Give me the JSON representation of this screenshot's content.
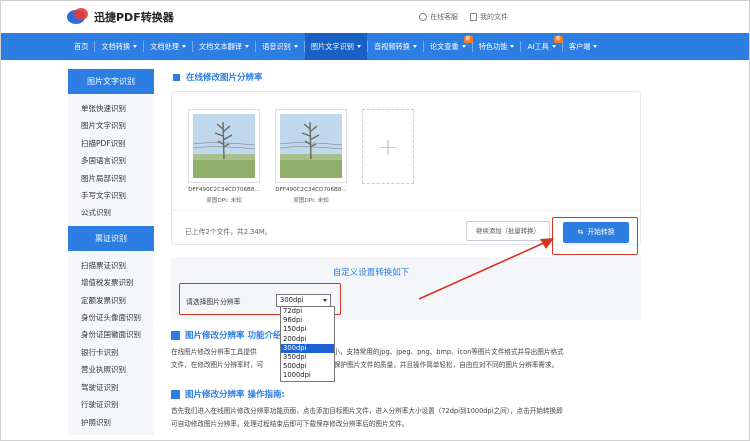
{
  "header": {
    "logo_text": "迅捷PDF转换器",
    "links": [
      "在线客服",
      "我的文件"
    ]
  },
  "nav": {
    "items": [
      {
        "label": "首页",
        "caret": false
      },
      {
        "label": "文档转换",
        "caret": true
      },
      {
        "label": "文档处理",
        "caret": true
      },
      {
        "label": "文档文本翻译",
        "caret": true
      },
      {
        "label": "语音识别",
        "caret": true
      },
      {
        "label": "图片文字识别",
        "caret": true,
        "active": true
      },
      {
        "label": "音视频转换",
        "caret": true
      },
      {
        "label": "论文查重",
        "caret": true,
        "badge": "新"
      },
      {
        "label": "特色功能",
        "caret": true
      },
      {
        "label": "AI工具",
        "caret": true,
        "badge": "新"
      },
      {
        "label": "客户端",
        "caret": true
      }
    ]
  },
  "sidebar": {
    "section1_title": "图片文字识别",
    "section1_items": [
      "单张快速识别",
      "图片文字识别",
      "扫描PDF识别",
      "多国语言识别",
      "图片局部识别",
      "手写文字识别",
      "公式识别"
    ],
    "section2_title": "票证识别",
    "section2_items": [
      "扫描票证识别",
      "增值税发票识别",
      "定额发票识别",
      "身份证头像面识别",
      "身份证国徽面识别",
      "银行卡识别",
      "营业执照识别",
      "驾驶证识别",
      "行驶证识别",
      "护照识别"
    ]
  },
  "main": {
    "title": "在线修改图片分辨率",
    "files": [
      {
        "name": "DFF490C2C34CD706B8...",
        "dpi": "原图DPI: 未知"
      },
      {
        "name": "DFF490C2C34CD706B8...",
        "dpi": "原图DPI: 未知"
      }
    ],
    "add_symbol": "+",
    "upload_count": "已上传2个文件，共2.34M。",
    "continue_button": "继续添加（批量转换）",
    "start_button": "开始转换",
    "settings_title": "自定义设置转换如下",
    "resolution_label": "请选择图片分辨率",
    "resolution_value": "300dpi",
    "resolution_options": [
      "72dpi",
      "96dpi",
      "150dpi",
      "200dpi",
      "300dpi",
      "350dpi",
      "500dpi",
      "1000dpi"
    ],
    "selected_option": "300dpi"
  },
  "intro": {
    "title_visible": "图片修改分辨率 功能介绍",
    "paragraph_left": "在线图片修改分辨率工具提供",
    "paragraph_right": "大小，支持常用的jpg、jpeg、png、bmp、icon等图片文件格式并导出图片格式",
    "paragraph_line2_left": "文件，在修改图片分辨率时，可",
    "paragraph_line2_right": "地保护图片文件的质量，并且操作简单轻松，自由应对不同的图片分辨率需求。"
  },
  "guide": {
    "title": "图片修改分辨率 操作指南:",
    "paragraph_line1": "首先我们进入在线图片修改分辨率功能页面，点击添加目标图片文件，进入分辨率大小设置（72dpi到1000dpi之间），点击开始转换即",
    "paragraph_line2": "可自动修改图片分辨率，处理过程结束后即可下载保存修改分辨率后的图片文件。"
  },
  "colors": {
    "brand_blue": "#2d7ee2",
    "highlight_red": "#d9321f",
    "selected_blue": "#1e63d6"
  }
}
